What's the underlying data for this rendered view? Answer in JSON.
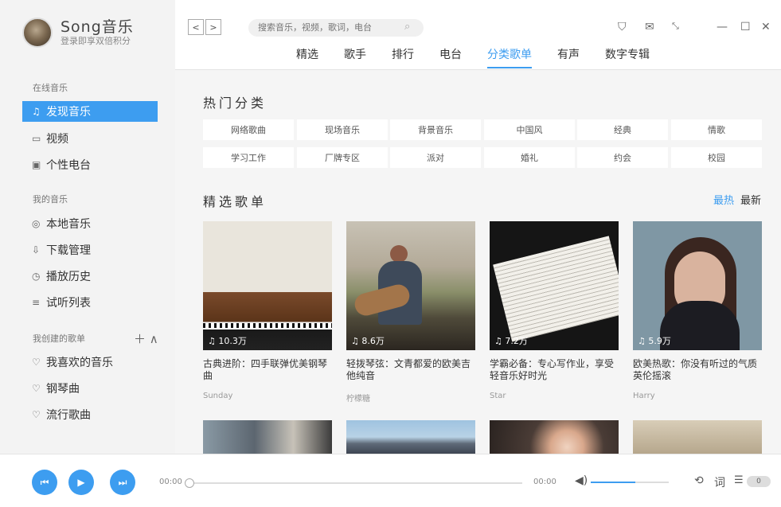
{
  "brand": {
    "name": "Song音乐",
    "sub": "登录即享双倍积分"
  },
  "sidebar": {
    "online_title": "在线音乐",
    "online": [
      {
        "icon": "headphone-icon",
        "glyph": "♫",
        "label": "发现音乐"
      },
      {
        "icon": "video-icon",
        "glyph": "▭",
        "label": "视频"
      },
      {
        "icon": "radio-icon",
        "glyph": "▣",
        "label": "个性电台"
      }
    ],
    "mine_title": "我的音乐",
    "mine": [
      {
        "icon": "disc-icon",
        "glyph": "◎",
        "label": "本地音乐"
      },
      {
        "icon": "download-icon",
        "glyph": "⇩",
        "label": "下载管理"
      },
      {
        "icon": "history-icon",
        "glyph": "◷",
        "label": "播放历史"
      },
      {
        "icon": "list-icon",
        "glyph": "≡",
        "label": "试听列表"
      }
    ],
    "created_title": "我创建的歌单",
    "created": [
      {
        "icon": "heart-icon",
        "glyph": "♡",
        "label": "我喜欢的音乐"
      },
      {
        "icon": "heart-icon",
        "glyph": "♡",
        "label": "钢琴曲"
      },
      {
        "icon": "heart-icon",
        "glyph": "♡",
        "label": "流行歌曲"
      }
    ]
  },
  "search": {
    "placeholder": "搜索音乐，视频，歌词，电台"
  },
  "tabs": [
    "精选",
    "歌手",
    "排行",
    "电台",
    "分类歌单",
    "有声",
    "数字专辑"
  ],
  "main": {
    "hot_title": "热门分类",
    "categories": [
      "网络歌曲",
      "现场音乐",
      "背景音乐",
      "中国风",
      "经典",
      "情歌",
      "学习工作",
      "厂牌专区",
      "派对",
      "婚礼",
      "约会",
      "校园"
    ],
    "featured_title": "精选歌单",
    "sort_hot": "最热",
    "sort_new": "最新",
    "cards": [
      {
        "plays": "10.3万",
        "title": "古典进阶：四手联弹优美钢琴曲",
        "author": "Sunday"
      },
      {
        "plays": "8.6万",
        "title": "轻拨琴弦：文青都爱的欧美吉他纯音",
        "author": "柠檬糖"
      },
      {
        "plays": "7.2万",
        "title": "学霸必备：专心写作业，享受轻音乐好时光",
        "author": "Star"
      },
      {
        "plays": "5.9万",
        "title": "欧美热歌：你没有听过的气质英伦摇滚",
        "author": "Harry"
      }
    ]
  },
  "player": {
    "current": "00:00",
    "total": "00:00",
    "lyric": "词",
    "queue": "0"
  },
  "colors": {
    "accent": "#3d9df0"
  }
}
